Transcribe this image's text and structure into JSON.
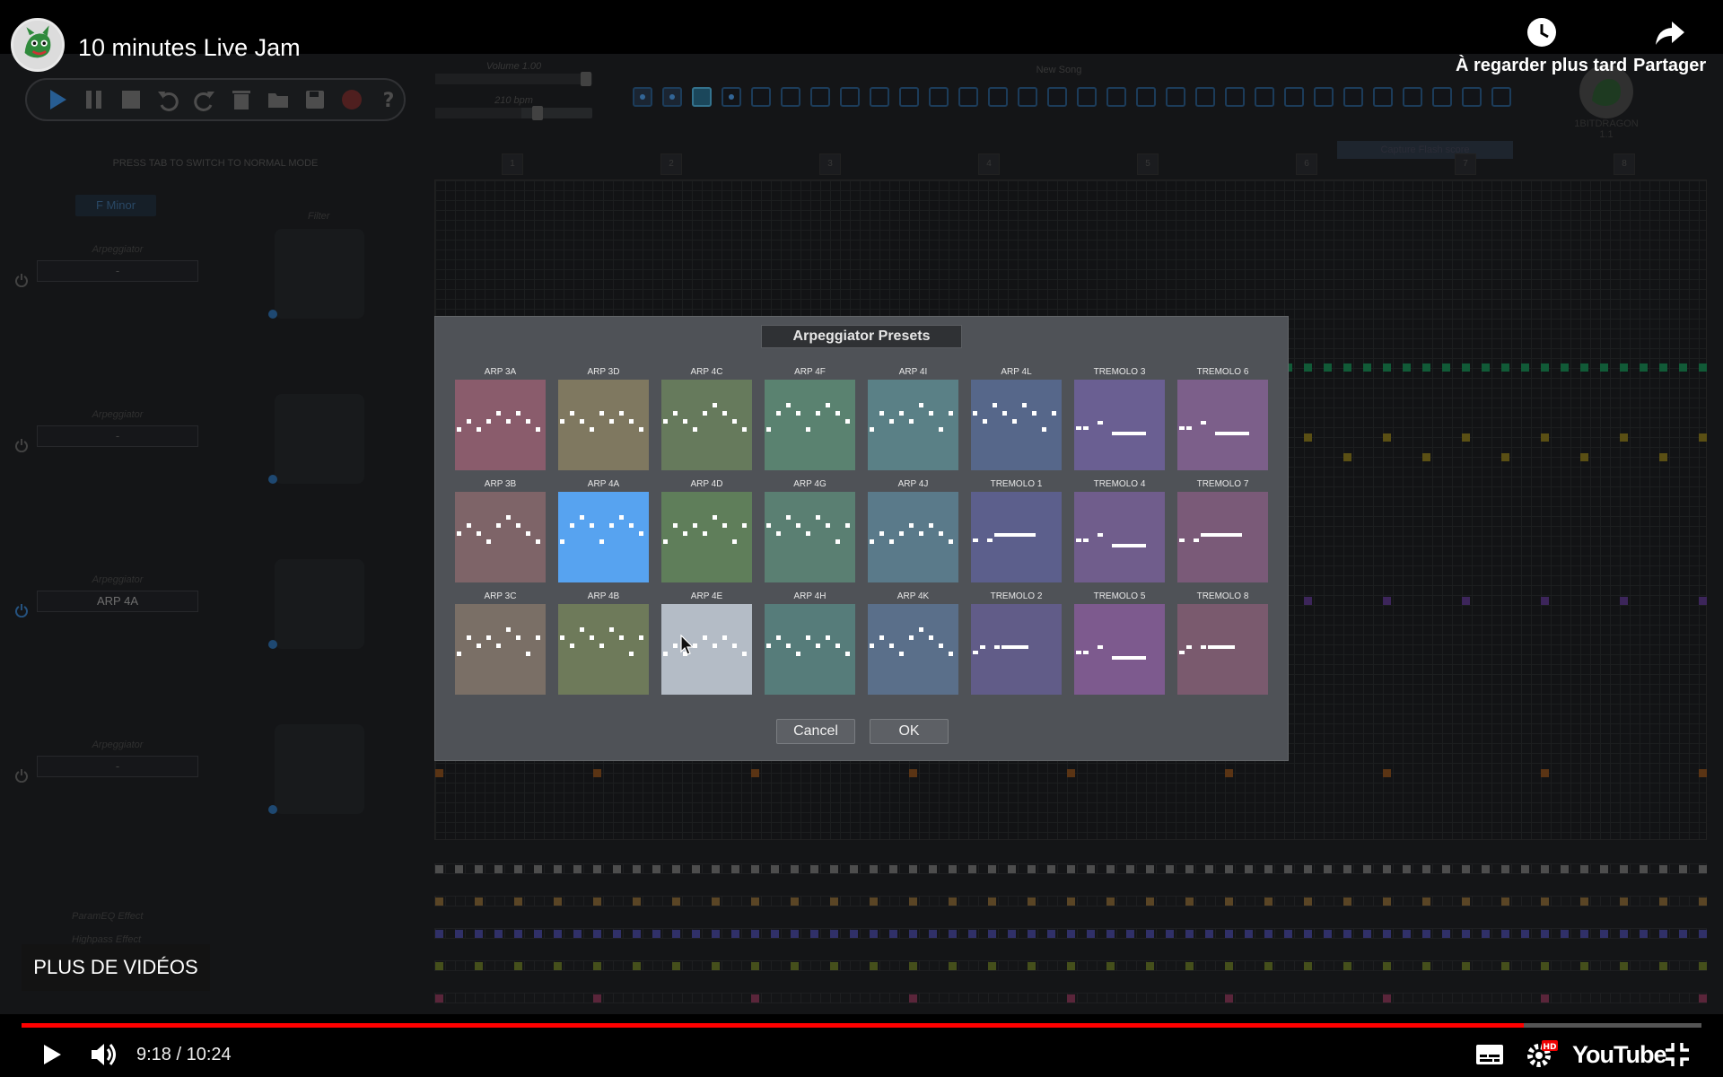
{
  "video": {
    "title": "10 minutes Live Jam",
    "watch_later_label": "À regarder plus tard",
    "share_label": "Partager",
    "more_videos_label": "PLUS DE VIDÉOS",
    "time_display": "9:18 / 10:24",
    "progress_fraction": 0.894,
    "brand": "YouTube",
    "hd_badge": "HD"
  },
  "app": {
    "volume_label": "Volume 1.00",
    "tempo_label": "210 bpm",
    "song_name": "New Song",
    "capture_label": "Capture Flash score",
    "profile_name": "1BITDRAGON",
    "profile_sub": "1.1",
    "mode_hint": "PRESS TAB TO SWITCH TO NORMAL MODE",
    "scale": "F Minor",
    "filter_label": "Filter",
    "tracks": [
      {
        "label": "Arpeggiator",
        "value": "-"
      },
      {
        "label": "Arpeggiator",
        "value": "-"
      },
      {
        "label": "Arpeggiator",
        "value": "ARP 4A"
      },
      {
        "label": "Arpeggiator",
        "value": "-"
      }
    ],
    "effects": [
      "ParamEQ Effect",
      "Highpass Effect"
    ],
    "bar_numbers": [
      "1",
      "2",
      "3",
      "4",
      "5",
      "6",
      "7",
      "8"
    ]
  },
  "dialog": {
    "title": "Arpeggiator Presets",
    "cancel_label": "Cancel",
    "ok_label": "OK",
    "presets": [
      {
        "label": "ARP 3A",
        "color": "#8a5c6c"
      },
      {
        "label": "ARP 3D",
        "color": "#7f7860"
      },
      {
        "label": "ARP 4C",
        "color": "#667a5c"
      },
      {
        "label": "ARP 4F",
        "color": "#5a8270"
      },
      {
        "label": "ARP 4I",
        "color": "#5a8086"
      },
      {
        "label": "ARP 4L",
        "color": "#56678a"
      },
      {
        "label": "TREMOLO 3",
        "color": "#6a5f92"
      },
      {
        "label": "TREMOLO 6",
        "color": "#7c5f8a"
      },
      {
        "label": "ARP 3B",
        "color": "#7e6468"
      },
      {
        "label": "ARP 4A",
        "color": "#57a3f0"
      },
      {
        "label": "ARP 4D",
        "color": "#5f7e5a"
      },
      {
        "label": "ARP 4G",
        "color": "#5a7f72"
      },
      {
        "label": "ARP 4J",
        "color": "#5a7a8a"
      },
      {
        "label": "TREMOLO 1",
        "color": "#5c5f8c"
      },
      {
        "label": "TREMOLO 4",
        "color": "#705d8c"
      },
      {
        "label": "TREMOLO 7",
        "color": "#7a5a78"
      },
      {
        "label": "ARP 3C",
        "color": "#7a6f66"
      },
      {
        "label": "ARP 4B",
        "color": "#6e7a5a"
      },
      {
        "label": "ARP 4E",
        "color": "#b4bcc6"
      },
      {
        "label": "ARP 4H",
        "color": "#567c7a"
      },
      {
        "label": "ARP 4K",
        "color": "#5a6f8a"
      },
      {
        "label": "TREMOLO 2",
        "color": "#615c88"
      },
      {
        "label": "TREMOLO 5",
        "color": "#7d5a8e"
      },
      {
        "label": "TREMOLO 8",
        "color": "#7a5a6e"
      }
    ],
    "selected_preset": "ARP 4A",
    "hovered_preset": "ARP 4E"
  }
}
